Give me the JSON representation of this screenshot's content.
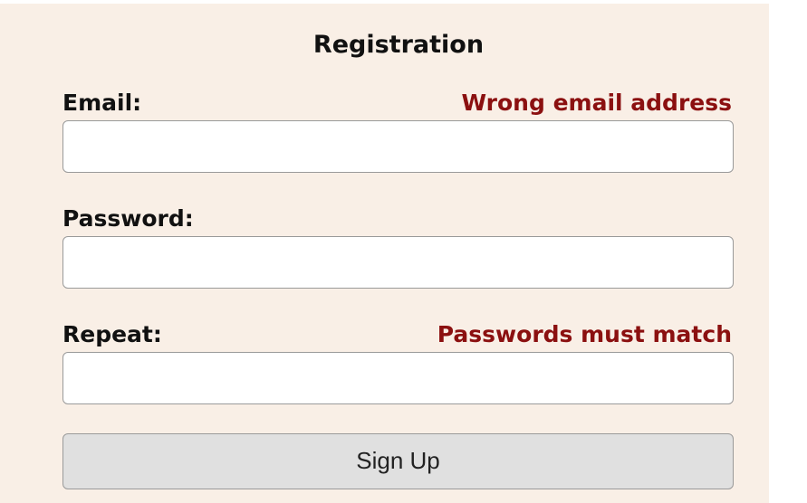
{
  "form": {
    "title": "Registration",
    "fields": [
      {
        "label": "Email:",
        "error": "Wrong email address",
        "value": "",
        "placeholder": ""
      },
      {
        "label": "Password:",
        "error": "",
        "value": "",
        "placeholder": ""
      },
      {
        "label": "Repeat:",
        "error": "Passwords must match",
        "value": "",
        "placeholder": ""
      }
    ],
    "submit_label": "Sign Up"
  },
  "colors": {
    "background": "#f9efe6",
    "error": "#8b1010",
    "button": "#e0e0e0"
  }
}
